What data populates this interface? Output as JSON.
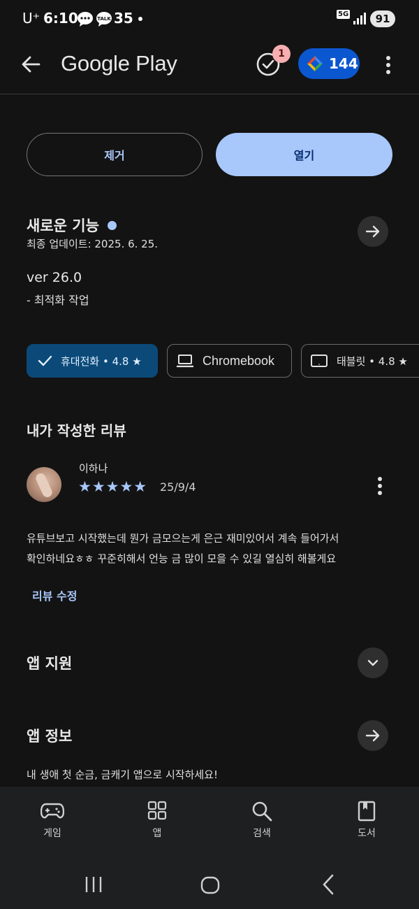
{
  "status_bar": {
    "carrier": "U⁺",
    "time": "6:10",
    "notification_count": "35",
    "network": "5G",
    "battery": "91"
  },
  "app_bar": {
    "title": "Google Play",
    "notification_badge": "1",
    "points": "144"
  },
  "actions": {
    "remove_label": "제거",
    "open_label": "열기"
  },
  "whats_new": {
    "title": "새로운 기능",
    "updated": "최종 업데이트: 2025. 6. 25.",
    "version": "ver 26.0",
    "note": "- 최적화 작업"
  },
  "devices": {
    "phone": "휴대전화 • 4.8 ★",
    "chromebook": "Chromebook",
    "tablet": "태블릿 • 4.8 ★"
  },
  "my_review": {
    "heading": "내가 작성한 리뷰",
    "author": "이하나",
    "date": "25/9/4",
    "rating": 5,
    "stars": "★★★★★",
    "text_line1": "유튜브보고 시작했는데 뭔가 금모으는게 은근 재미있어서 계속 들어가서",
    "text_line2": "확인하네요ㅎㅎ 꾸준히해서 언능 금 많이 모을 수 있길 열심히 해볼게요",
    "edit_label": "리뷰 수정"
  },
  "app_support": {
    "title": "앱 지원"
  },
  "app_info": {
    "title": "앱 정보",
    "description": "내 생애 첫 순금, 금캐기 앱으로 시작하세요!"
  },
  "bottom_nav": {
    "games": "게임",
    "apps": "앱",
    "search": "검색",
    "books": "도서"
  },
  "colors": {
    "background": "#131313",
    "accent": "#a8c7fa",
    "selected_chip": "#0b4a78",
    "points_pill": "#0b57d0"
  }
}
